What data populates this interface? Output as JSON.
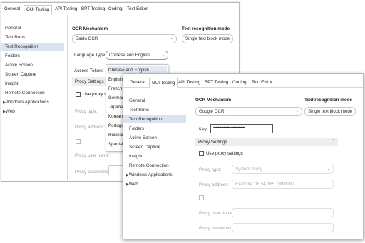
{
  "tabs": [
    "General",
    "GUI Testing",
    "API Testing",
    "BPT Testing",
    "Coding",
    "Text Editor"
  ],
  "sidebar": [
    "General",
    "Test Runs",
    "Text Recognition",
    "Folders",
    "Active Screen",
    "Screen Capture",
    "Insight",
    "Remote Connection",
    "Windows Applications",
    "Web"
  ],
  "back": {
    "ocr_mechanism_label": "OCR Mechanism",
    "ocr_mechanism_value": "Baidu OCR",
    "text_mode_label": "Text recognition mode",
    "text_mode_value": "Single text block mode",
    "language_label": "Language Type:",
    "language_value": "Chinese and English",
    "token_label": "Access Token:",
    "proxy_settings": "Proxy Settings",
    "use_proxy": "Use proxy setti",
    "proxy_type": "Proxy type:",
    "proxy_address": "Proxy address:",
    "proxy_user": "Proxy user name:",
    "proxy_password": "Proxy password:",
    "language_options": [
      "Chinese and English",
      "English",
      "French",
      "German",
      "Japanese",
      "Korean",
      "Portuguese",
      "Russian",
      "Spanish"
    ]
  },
  "front": {
    "ocr_mechanism_label": "OCR Mechanism",
    "ocr_mechanism_value": "Google OCR",
    "text_mode_label": "Text recognition mode",
    "text_mode_value": "Single text block mode",
    "key_label": "Key:",
    "key_value": "••••••••••••••••••••••••••••",
    "proxy_settings": "Proxy Settings",
    "use_proxy": "Use proxy settings",
    "proxy_type": "Proxy type:",
    "proxy_type_value": "System Proxy",
    "proxy_address": "Proxy address:",
    "proxy_address_placeholder": "Example: 16.54.165.190:8080",
    "proxy_user": "Proxy user name:",
    "proxy_password": "Proxy password:"
  }
}
